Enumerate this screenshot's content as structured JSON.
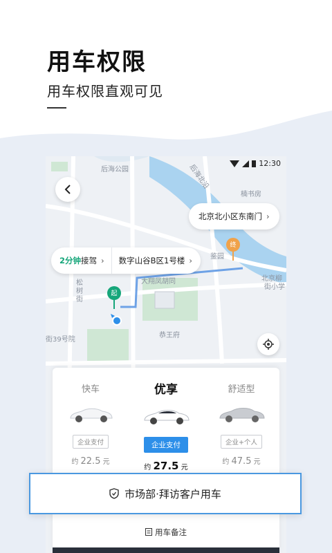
{
  "hero": {
    "title": "用车权限",
    "subtitle": "用车权限直观可见"
  },
  "status_bar": {
    "time": "12:30"
  },
  "map": {
    "labels": {
      "houhai_park": "后海公园",
      "road_houhai": "后海北沿",
      "nanshufang": "楠书房",
      "jianyuan": "鉴园",
      "dafengxiang": "大翔凤胡同",
      "beijing_school": "北京柳",
      "beijing_school2": "街小学",
      "songshu": "松",
      "songshu2": "树",
      "songshu3": "街",
      "gongwangfu": "恭王府",
      "no39": "街39号院",
      "liu": "柳",
      "hao": "号"
    },
    "end_marker": "终",
    "start_marker": "起",
    "end_bubble": {
      "label": "北京北小区东南门"
    },
    "start_bubble": {
      "eta": "2分钟",
      "eta_suffix": "接驾",
      "label": "数字山谷B区1号楼"
    }
  },
  "options": [
    {
      "name": "快车",
      "tag": "企业支付",
      "price_prefix": "约",
      "price": "22.5",
      "unit": "元",
      "active": false
    },
    {
      "name": "优享",
      "tag": "企业支付",
      "price_prefix": "约",
      "price": "27.5",
      "unit": "元",
      "active": true
    },
    {
      "name": "舒适型",
      "tag": "企业+个人",
      "price_prefix": "约",
      "price": "47.5",
      "unit": "元",
      "active": false
    }
  ],
  "purpose": {
    "label": "市场部·拜访客户用车"
  },
  "note": {
    "label": "用车备注"
  },
  "colors": {
    "accent": "#2d8fe9",
    "green": "#16a67a",
    "marker_orange": "#f0a24a",
    "route": "#6ea2e6"
  }
}
